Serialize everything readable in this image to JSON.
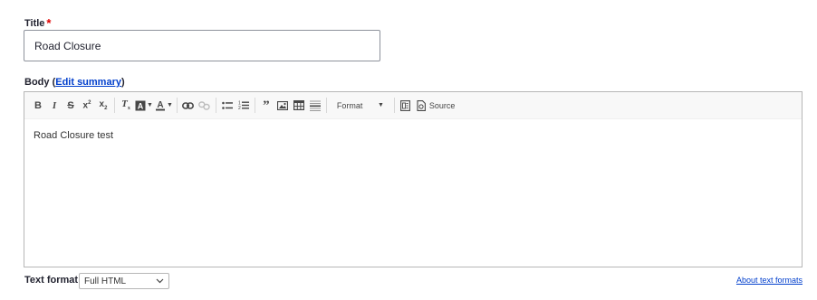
{
  "title_field": {
    "label": "Title",
    "required_mark": "*",
    "value": "Road Closure"
  },
  "body_field": {
    "label": "Body",
    "edit_summary_link": "Edit summary",
    "paren_open": "(",
    "paren_close": ")"
  },
  "toolbar": {
    "format_label": "Format",
    "source_label": "Source",
    "icons": [
      "bold-icon",
      "italic-icon",
      "strikethrough-icon",
      "superscript-icon",
      "subscript-icon",
      "remove-format-icon",
      "background-color-icon",
      "text-color-icon",
      "link-icon",
      "unlink-icon",
      "bulleted-list-icon",
      "numbered-list-icon",
      "blockquote-icon",
      "image-icon",
      "table-icon",
      "horizontal-line-icon",
      "format-dropdown",
      "templates-icon",
      "source-icon"
    ]
  },
  "editor": {
    "content": "Road Closure test"
  },
  "text_format": {
    "label": "Text format",
    "selected": "Full HTML",
    "about_link": "About text formats"
  },
  "colors": {
    "link": "#003ecc",
    "required": "#e00000",
    "toolbar_bg": "#f8f8f8",
    "border": "#b6b6b6"
  }
}
